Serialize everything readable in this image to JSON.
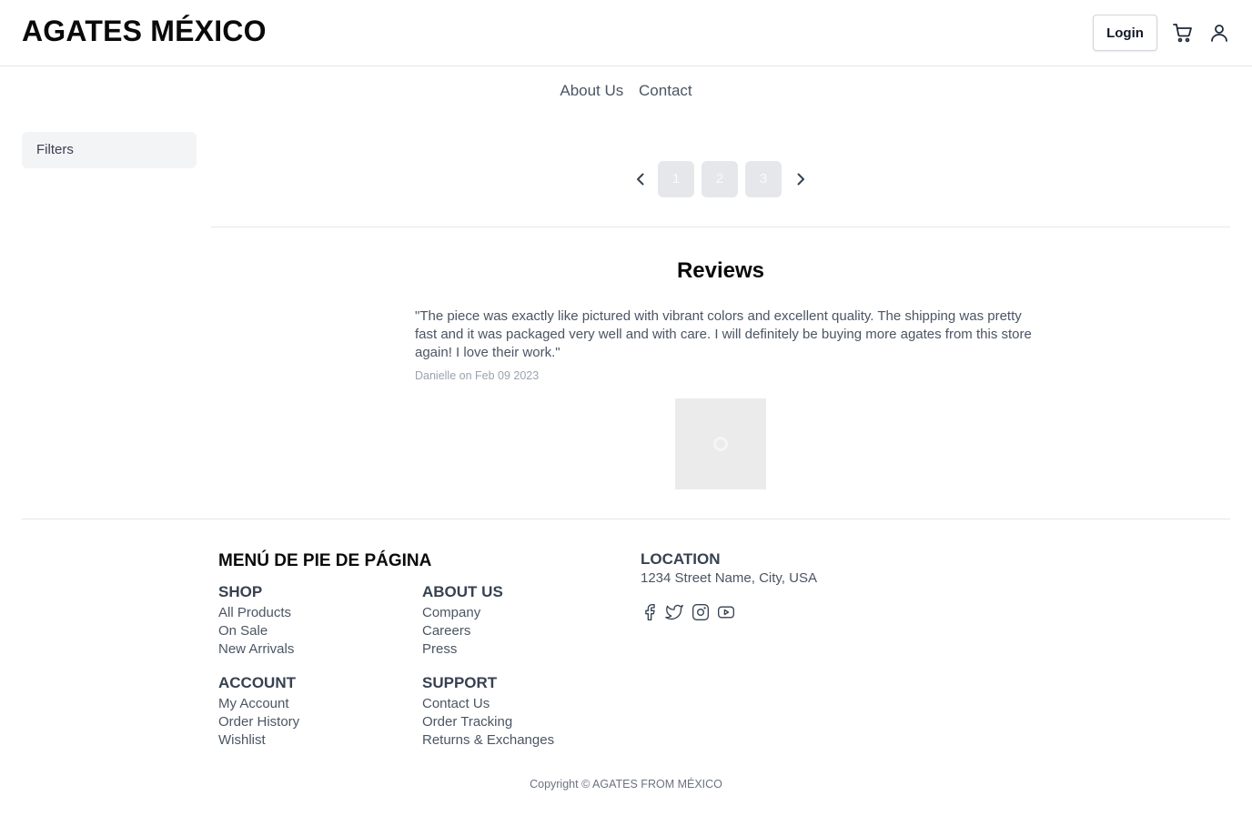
{
  "header": {
    "brand": "AGATES MÉXICO",
    "login_label": "Login",
    "cart_icon": "cart-icon",
    "user_icon": "user-icon"
  },
  "nav": {
    "items": [
      {
        "label": "About Us"
      },
      {
        "label": "Contact"
      }
    ]
  },
  "sidebar": {
    "filters_label": "Filters"
  },
  "pagination": {
    "prev_icon": "chevron-left-icon",
    "next_icon": "chevron-right-icon",
    "pages": [
      "1",
      "2",
      "3"
    ]
  },
  "reviews": {
    "title": "Reviews",
    "items": [
      {
        "text": "\"The piece was exactly like pictured with vibrant colors and excellent quality. The shipping was pretty fast and it was packaged very well and with care. I will definitely be buying more agates from this store again! I love their work.\"",
        "meta": "Danielle on Feb 09 2023"
      }
    ]
  },
  "footer": {
    "title": "MENÚ DE PIE DE PÁGINA",
    "columns": [
      {
        "heading": "SHOP",
        "links": [
          "All Products",
          "On Sale",
          "New Arrivals"
        ]
      },
      {
        "heading": "ABOUT US",
        "links": [
          "Company",
          "Careers",
          "Press"
        ]
      },
      {
        "heading": "ACCOUNT",
        "links": [
          "My Account",
          "Order History",
          "Wishlist"
        ]
      },
      {
        "heading": "SUPPORT",
        "links": [
          "Contact Us",
          "Order Tracking",
          "Returns & Exchanges"
        ]
      }
    ],
    "location": {
      "heading": "LOCATION",
      "address": "1234 Street Name, City, USA"
    },
    "social_icons": [
      "facebook-icon",
      "twitter-icon",
      "instagram-icon",
      "youtube-icon"
    ],
    "copyright": "Copyright © AGATES FROM MÉXICO"
  },
  "colors": {
    "text_primary": "#0a0a0a",
    "text_secondary": "#4b5563",
    "muted": "#9ca3af",
    "border": "#e5e7eb",
    "page_button_bg": "#e5e7eb"
  }
}
